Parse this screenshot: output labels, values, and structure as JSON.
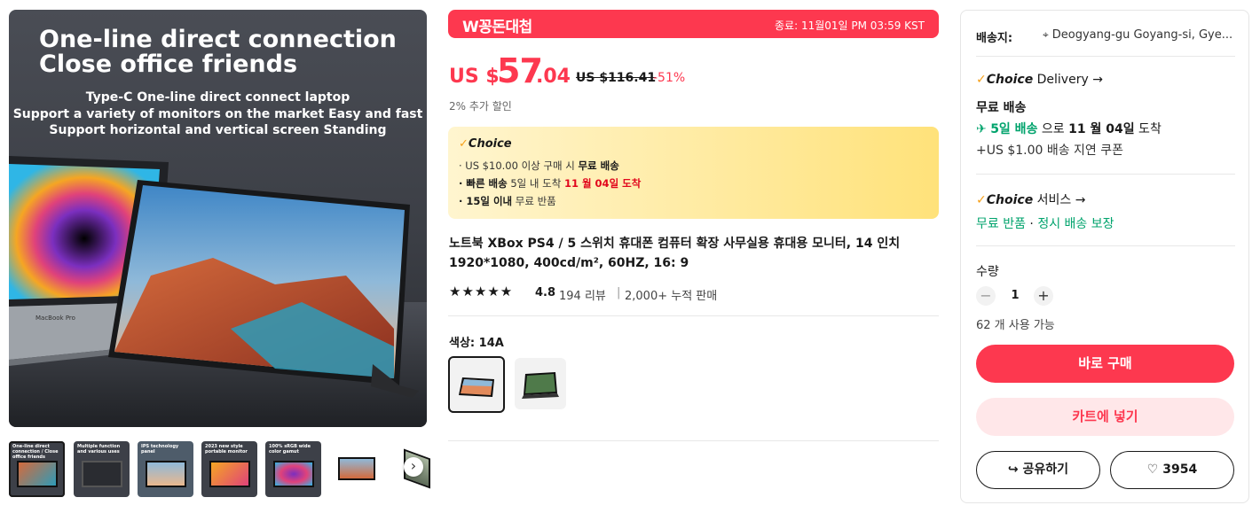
{
  "gallery": {
    "headline": [
      "One-line direct connection",
      "Close office friends"
    ],
    "subtitle": [
      "Type-C One-line direct connect laptop",
      "Support a variety of monitors on the market Easy and fast",
      "Support horizontal and vertical screen Standing"
    ],
    "laptop_label": "MacBook Pro",
    "thumbnails": [
      {
        "caption": "One-line direct connection / Close office friends",
        "style": "dark"
      },
      {
        "caption": "Multiple function and various uses",
        "style": "dark"
      },
      {
        "caption": "IPS technology panel",
        "style": "dark"
      },
      {
        "caption": "2023 new style portable monitor",
        "style": "dark"
      },
      {
        "caption": "100% sRGB wide color gamut",
        "style": "dark"
      },
      {
        "caption": "",
        "style": "light"
      },
      {
        "caption": "",
        "style": "light"
      }
    ],
    "next_icon": "chevron-right-icon"
  },
  "promo": {
    "logo": "W꽁돈대첩",
    "end_time": "종료: 11월01일 PM 03:59 KST"
  },
  "price": {
    "currency": "US $",
    "integer": "57",
    "decimal": ".04",
    "original": "US $116.41",
    "discount": "-51%",
    "extra_discount": "2% 추가 할인"
  },
  "choice_box": {
    "title": "Choice",
    "line1_prefix": "· US $10.00 이상 구매 시 ",
    "line1_bold": "무료 배송",
    "line2_bold": "· 빠른 배송",
    "line2_mid": " 5일 내 도착 ",
    "line2_red": "11 월 04일 도착",
    "line3_bold": "· 15일 이내",
    "line3_rest": " 무료 반품"
  },
  "product": {
    "title": "노트북 XBox PS4 / 5 스위치 휴대폰 컴퓨터 확장 사무실용 휴대용 모니터, 14 인치 1920*1080, 400cd/m², 60HZ, 16: 9",
    "rating": "4.8",
    "reviews": "194 리뷰",
    "sold": "2,000+ 누적 판매",
    "stars": "★★★★★",
    "color_label": "색상: 14A"
  },
  "panel": {
    "ship_label": "배송지:",
    "ship_address": "Deogyang-gu Goyang-si, Gye...",
    "choice_word": "Choice",
    "delivery_label": " Delivery →",
    "free_shipping": "무료 배송",
    "fast_prefix": "5일 배송",
    "fast_mid": " 으로 ",
    "fast_date": "11 월 04일",
    "fast_suffix": " 도착",
    "coupon": "+US $1.00 배송 지연 쿠폰",
    "service_label": " 서비스 →",
    "free_return": "무료 반품",
    "dot": " · ",
    "on_time": "정시 배송 보장",
    "qty_label": "수량",
    "qty_value": "1",
    "available": "62 개 사용 가능",
    "buy_now": "바로 구매",
    "add_cart": "카트에 넣기",
    "share": "공유하기",
    "wishlist_count": "3954"
  },
  "colors": {
    "accent": "#fd384f",
    "choice_check": "#f6a01a",
    "green": "#00a36c"
  }
}
